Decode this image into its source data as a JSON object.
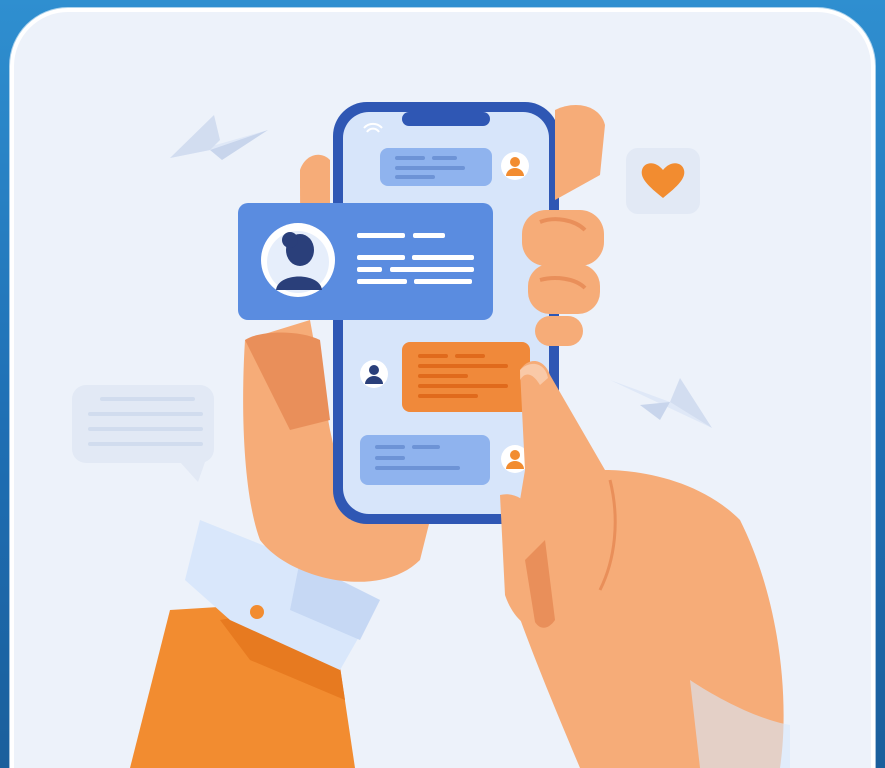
{
  "illustration": {
    "subject": "messaging-app-on-smartphone",
    "colors": {
      "background_outer": "#2480c4",
      "card": "#edf2fa",
      "phone_frame": "#2f57b4",
      "phone_screen": "#d7e5fa",
      "bubble_blue": "#8fb3ee",
      "bubble_orange": "#f0893a",
      "popup_card": "#5a8ce0",
      "skin": "#f6ac78",
      "skin_shadow": "#e98f5a",
      "sleeve_light": "#d9e7fb",
      "sleeve_orange": "#f28c30",
      "heart": "#f28c30",
      "faded_bubble": "#e2e9f5",
      "paper_plane": "#dfe8f7"
    },
    "icons": [
      "paper-plane-icon",
      "heart-icon",
      "avatar-icon",
      "wifi-icon",
      "chat-bubble-icon"
    ]
  }
}
